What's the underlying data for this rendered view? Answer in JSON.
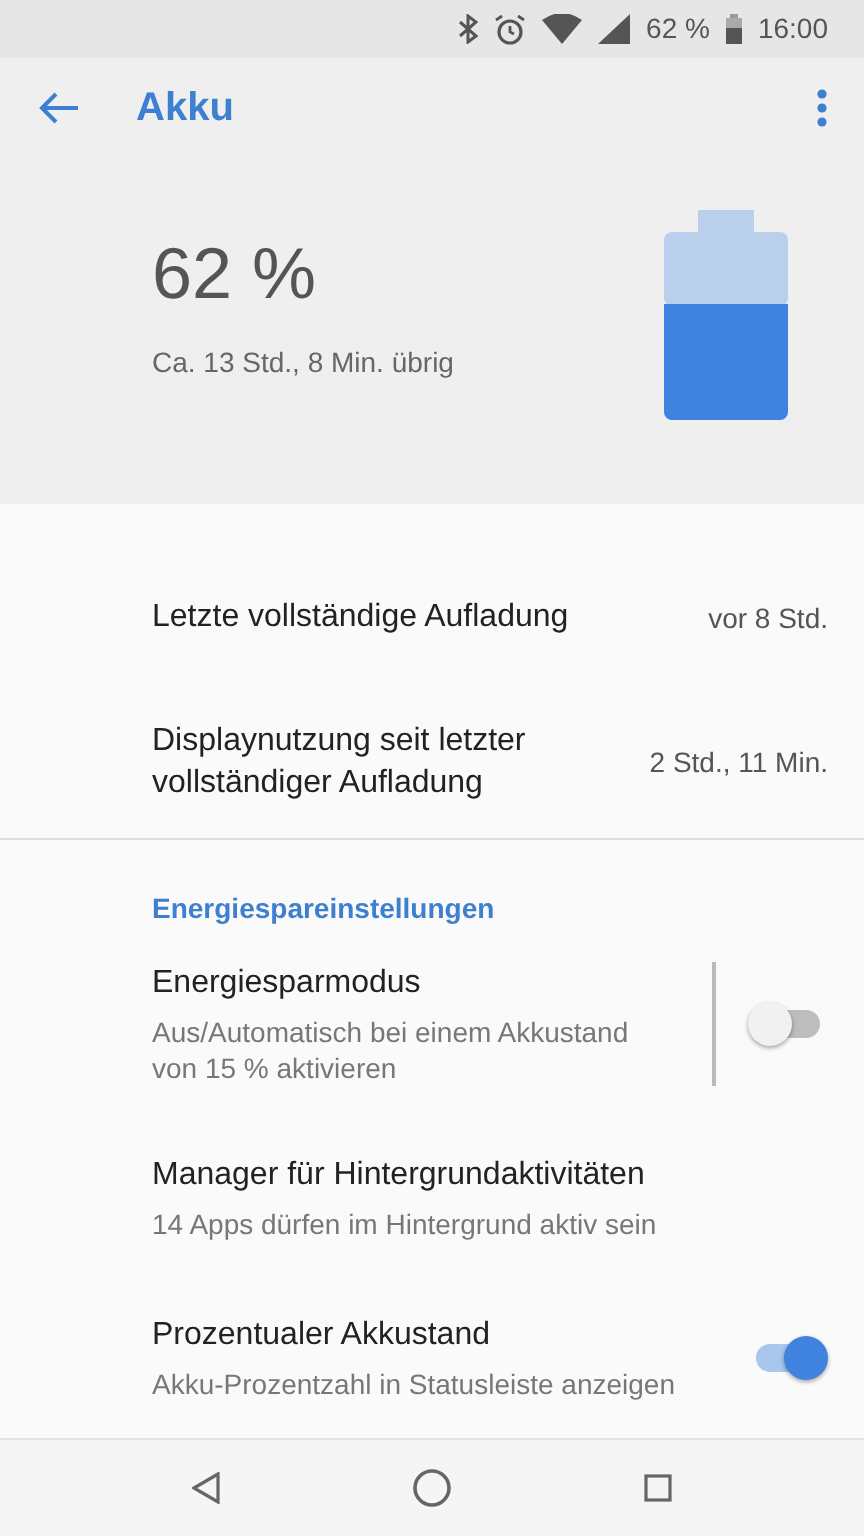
{
  "status_bar": {
    "battery_text": "62 %",
    "time": "16:00"
  },
  "app_bar": {
    "title": "Akku"
  },
  "summary": {
    "percent": "62 %",
    "remaining": "Ca. 13 Std., 8 Min. übrig"
  },
  "items": [
    {
      "kind": "info",
      "title": "Letzte vollständige Aufladung",
      "value": "vor 8 Std."
    },
    {
      "kind": "info",
      "title": "Displaynutzung seit letzter vollständiger Aufladung",
      "value": "2 Std., 11 Min.",
      "divider_below": true
    },
    {
      "kind": "header",
      "title": "Energiespareinstellungen"
    },
    {
      "kind": "split_switch",
      "title": "Energiesparmodus",
      "subtitle": "Aus/Automatisch bei einem Akkustand von 15 % aktivieren",
      "on": false
    },
    {
      "kind": "nav",
      "title": "Manager für Hintergrundaktivitäten",
      "subtitle": "14 Apps dürfen im Hintergrund aktiv sein"
    },
    {
      "kind": "switch",
      "title": "Prozentualer Akkustand",
      "subtitle": "Akku-Prozentzahl in Statusleiste anzeigen",
      "on": true
    }
  ]
}
